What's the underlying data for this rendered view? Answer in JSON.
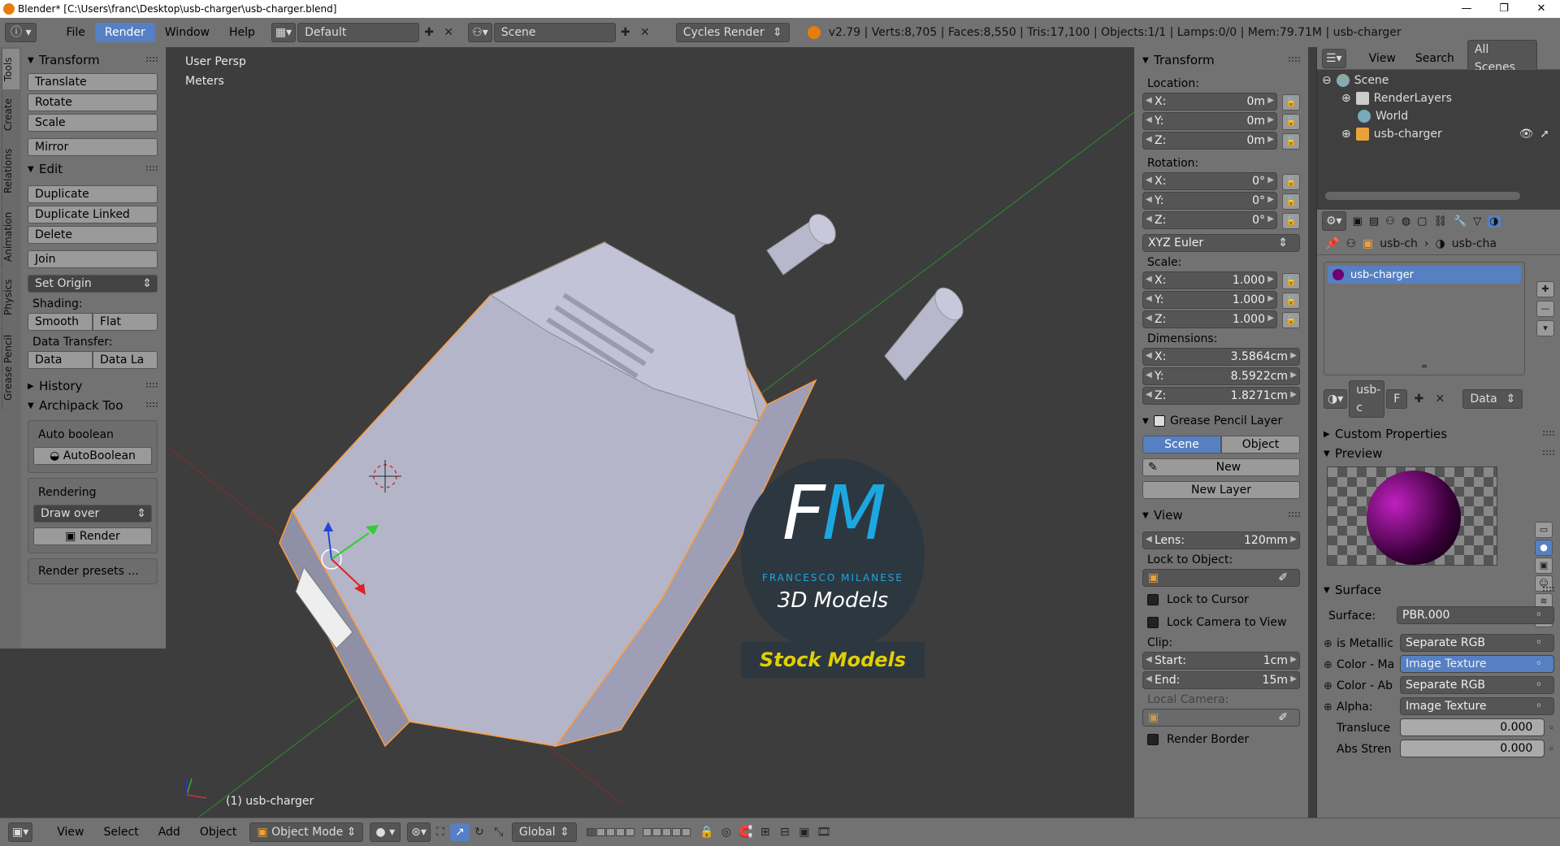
{
  "window": {
    "title": "Blender* [C:\\Users\\franc\\Desktop\\usb-charger\\usb-charger.blend]",
    "minimize": "—",
    "maximize": "❐",
    "close": "✕"
  },
  "header": {
    "menus": [
      "File",
      "Render",
      "Window",
      "Help"
    ],
    "active_menu": "Render",
    "layout": "Default",
    "scene": "Scene",
    "engine": "Cycles Render",
    "stats": "v2.79 | Verts:8,705 | Faces:8,550 | Tris:17,100 | Objects:1/1 | Lamps:0/0 | Mem:79.71M | usb-charger"
  },
  "tool_tabs": [
    "Tools",
    "Create",
    "Relations",
    "Animation",
    "Physics",
    "Grease Pencil"
  ],
  "toolshelf": {
    "transform_title": "Transform",
    "translate": "Translate",
    "rotate": "Rotate",
    "scale": "Scale",
    "mirror": "Mirror",
    "edit_title": "Edit",
    "duplicate": "Duplicate",
    "duplicate_linked": "Duplicate Linked",
    "delete": "Delete",
    "join": "Join",
    "set_origin": "Set Origin",
    "shading_label": "Shading:",
    "smooth": "Smooth",
    "flat": "Flat",
    "data_transfer_label": "Data Transfer:",
    "data": "Data",
    "data_la": "Data La",
    "history_title": "History",
    "archipack_title": "Archipack Too",
    "auto_boolean_label": "Auto boolean",
    "autoboolean_btn": "AutoBoolean",
    "rendering_label": "Rendering",
    "draw_over": "Draw over",
    "render_btn": "Render",
    "render_presets": "Render presets ..."
  },
  "viewport": {
    "view_name": "User Persp",
    "units": "Meters",
    "object_label": "(1) usb-charger",
    "watermark_fm": "FM",
    "watermark_name": "FRANCESCO MILANESE",
    "watermark_sub": "3D Models",
    "stock_label": "Stock Models"
  },
  "npanel": {
    "transform_title": "Transform",
    "location_label": "Location:",
    "location": [
      {
        "axis": "X:",
        "value": "0m"
      },
      {
        "axis": "Y:",
        "value": "0m"
      },
      {
        "axis": "Z:",
        "value": "0m"
      }
    ],
    "rotation_label": "Rotation:",
    "rotation": [
      {
        "axis": "X:",
        "value": "0°"
      },
      {
        "axis": "Y:",
        "value": "0°"
      },
      {
        "axis": "Z:",
        "value": "0°"
      }
    ],
    "rotation_mode": "XYZ Euler",
    "scale_label": "Scale:",
    "scale": [
      {
        "axis": "X:",
        "value": "1.000"
      },
      {
        "axis": "Y:",
        "value": "1.000"
      },
      {
        "axis": "Z:",
        "value": "1.000"
      }
    ],
    "dimensions_label": "Dimensions:",
    "dimensions": [
      {
        "axis": "X:",
        "value": "3.5864cm"
      },
      {
        "axis": "Y:",
        "value": "8.5922cm"
      },
      {
        "axis": "Z:",
        "value": "1.8271cm"
      }
    ],
    "grease_title": "Grease Pencil Layer",
    "scene_tab": "Scene",
    "object_tab": "Object",
    "new_btn": "New",
    "new_layer_btn": "New Layer",
    "view_title": "View",
    "lens_label": "Lens:",
    "lens_value": "120mm",
    "lock_to_object": "Lock to Object:",
    "lock_to_cursor": "Lock to Cursor",
    "lock_camera": "Lock Camera to View",
    "clip_label": "Clip:",
    "clip_start_label": "Start:",
    "clip_start": "1cm",
    "clip_end_label": "End:",
    "clip_end": "15m",
    "local_camera": "Local Camera:",
    "render_border": "Render Border"
  },
  "outliner": {
    "view": "View",
    "search": "Search",
    "all_scenes": "All Scenes",
    "items": [
      "Scene",
      "RenderLayers",
      "World",
      "usb-charger"
    ]
  },
  "properties": {
    "breadcrumb_obj": "usb-ch",
    "breadcrumb_mat": "usb-cha",
    "material_slot": "usb-charger",
    "mat_name": "usb-c",
    "fake_user": "F",
    "link": "Data",
    "custom_props": "Custom Properties",
    "preview": "Preview",
    "surface_title": "Surface",
    "surface_label": "Surface:",
    "surface_value": "PBR.000",
    "inputs": [
      {
        "label": "is Metallic",
        "value": "Separate RGB",
        "highlight": false
      },
      {
        "label": "Color - Ma",
        "value": "Image Texture",
        "highlight": true
      },
      {
        "label": "Color - Ab",
        "value": "Separate RGB",
        "highlight": false
      },
      {
        "label": "Alpha:",
        "value": "Image Texture",
        "highlight": false
      }
    ],
    "transluce_label": "Transluce",
    "transluce_value": "0.000",
    "abs_label": "Abs Stren",
    "abs_value": "0.000"
  },
  "bottombar": {
    "view": "View",
    "select": "Select",
    "add": "Add",
    "object": "Object",
    "mode": "Object Mode",
    "orientation": "Global"
  }
}
